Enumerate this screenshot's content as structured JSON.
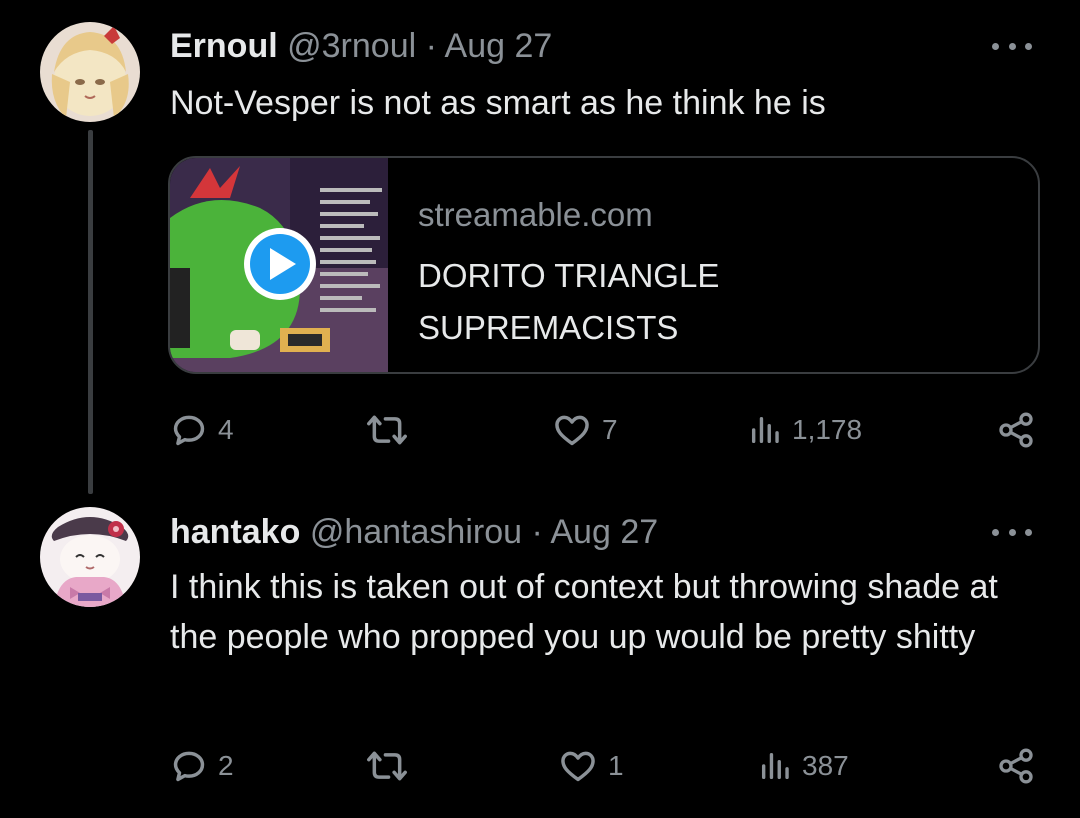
{
  "tweets": [
    {
      "display_name": "Ernoul",
      "handle": "@3rnoul",
      "separator": "·",
      "date": "Aug 27",
      "text": "Not-Vesper is not as smart as he think he is",
      "card": {
        "domain": "streamable.com",
        "title": "DORITO TRIANGLE SUPREMACISTS",
        "thumb_icon": "play-icon"
      },
      "actions": {
        "replies": "4",
        "retweets": "",
        "likes": "7",
        "views": "1,178"
      }
    },
    {
      "display_name": "hantako",
      "handle": "@hantashirou",
      "separator": "·",
      "date": "Aug 27",
      "text": "I think this is taken out of context but throwing shade at the people who propped you up would be pretty shitty",
      "actions": {
        "replies": "2",
        "retweets": "",
        "likes": "1",
        "views": "387"
      }
    }
  ],
  "icons": [
    "reply-icon",
    "retweet-icon",
    "like-icon",
    "views-icon",
    "share-icon",
    "more-icon"
  ],
  "colors": {
    "background": "#000000",
    "text_primary": "#e7e9ea",
    "text_secondary": "#8b9197",
    "border": "#3a3d40",
    "play_button": "#1d9bf0"
  }
}
